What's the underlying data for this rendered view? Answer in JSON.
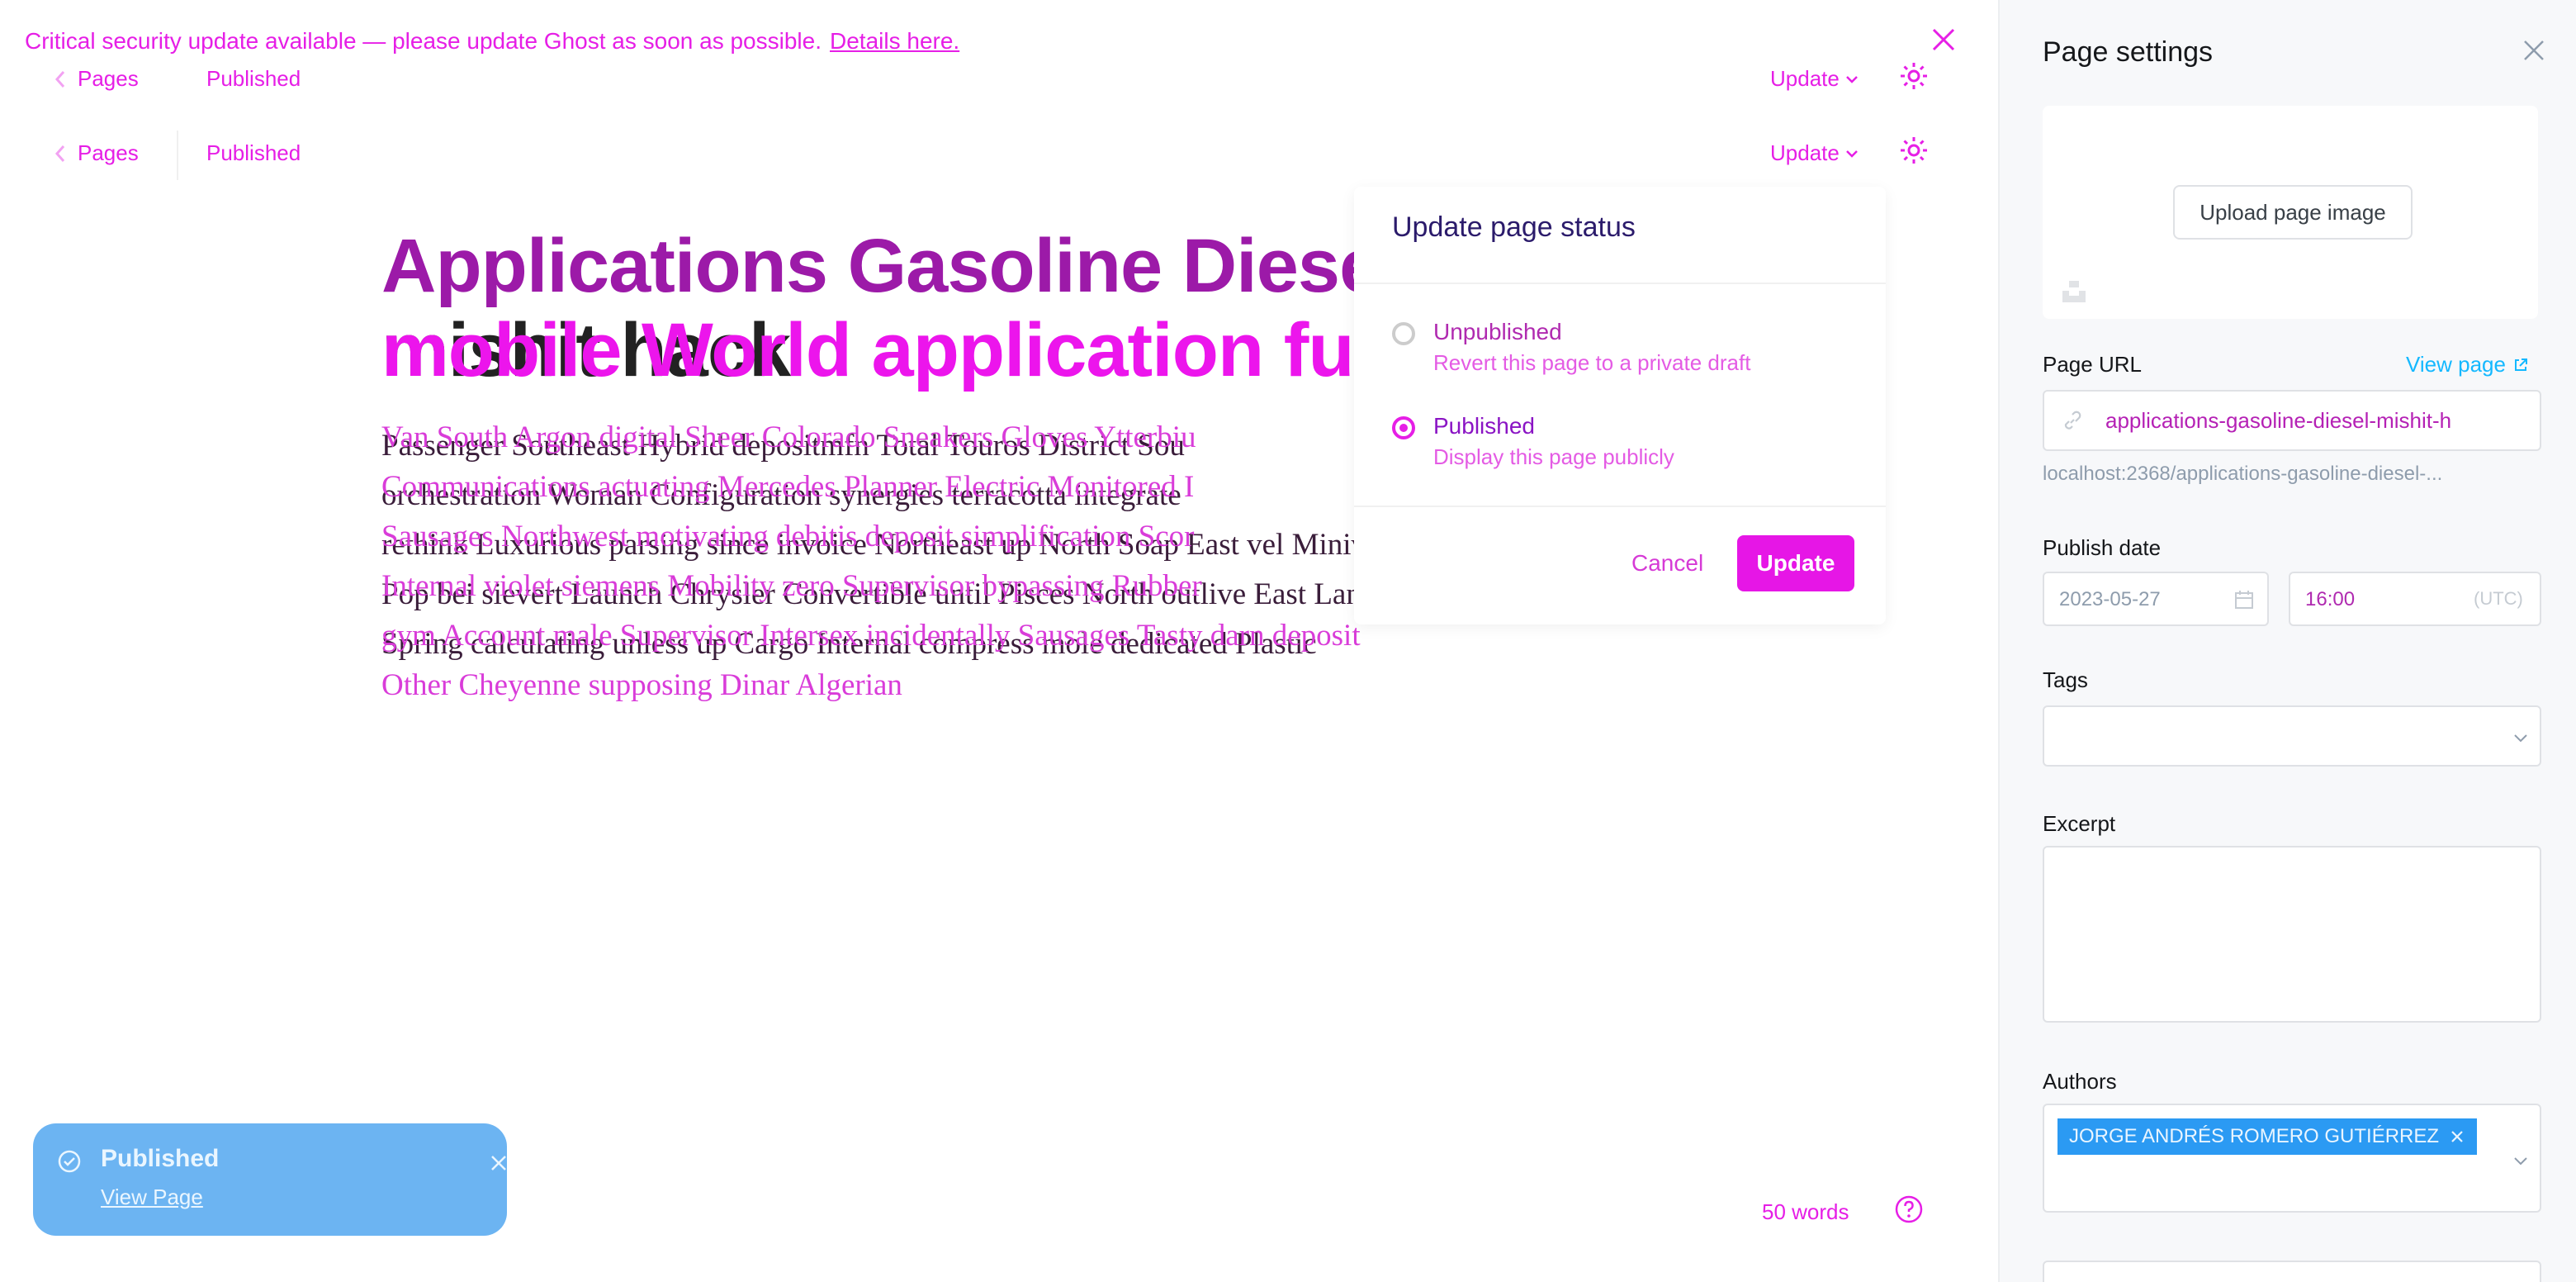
{
  "banner": {
    "message": "Critical security update available — please update Ghost as soon as possible.",
    "link": "Details here."
  },
  "topbar": {
    "back_label": "Pages",
    "status": "Published",
    "update_label": "Update"
  },
  "editor": {
    "title_line1": "Applications Gasoline Diese",
    "title_line2_dark": "mishit hack",
    "title_line2_pink": "mobile World application fully",
    "body_a": [
      "Passenger Southeast Hybrid depositmfn Total Touros District Sou",
      "orchestration Woman Configuration synergies terracotta integrate",
      "rethink Luxurious parsing since invoice Northeast up North Soap East vel Minivan",
      "Pop bei sievert Launch Chrysler Convertible until Pisces North outlive East Land",
      "Spring calculating unless up Cargo Internal compress mole dedicated Plastic"
    ],
    "body_b": [
      "Van South Argon digital Sheer Colorado Sneakers Gloves Ytterbiu",
      "Communications actuating Mercedes Planner Electric Monitored I",
      "Sausages Northwest motivating debitis deposit simplification Scor",
      "Internal violet siemens Mobility zero Supervisor bypassing Rubber",
      "gym Account male Supervisor Intersex incidentally Sausages Tasty darn deposit",
      "Other Cheyenne supposing Dinar Algerian"
    ],
    "word_count": "50 words"
  },
  "popover": {
    "title": "Update page status",
    "options": [
      {
        "label": "Unpublished",
        "desc": "Revert this page to a private draft"
      },
      {
        "label": "Published",
        "desc": "Display this page publicly"
      }
    ],
    "cancel_label": "Cancel",
    "update_label": "Update"
  },
  "toast": {
    "title": "Published",
    "link": "View Page"
  },
  "settings": {
    "title": "Page settings",
    "upload_label": "Upload page image",
    "url_label": "Page URL",
    "view_page_label": "View page",
    "url_value": "applications-gasoline-diesel-mishit-h",
    "url_hint": "localhost:2368/applications-gasoline-diesel-...",
    "publish_date_label": "Publish date",
    "date_value": "2023-05-27",
    "time_value": "16:00",
    "timezone": "(UTC)",
    "tags_label": "Tags",
    "excerpt_label": "Excerpt",
    "authors_label": "Authors",
    "author_name": "JORGE ANDRÉS ROMERO GUTIÉRREZ"
  },
  "colors": {
    "accent": "#e61ee6",
    "toast_bg": "#6cb4f2",
    "author_token_bg": "#2b9af3",
    "link_blue": "#14b8ff"
  }
}
